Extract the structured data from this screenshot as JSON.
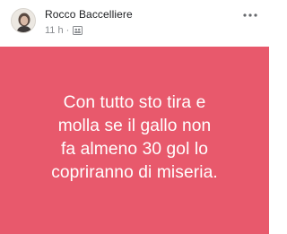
{
  "post": {
    "author": "Rocco Baccelliere",
    "time": "11 h",
    "separator": "·",
    "audience_icon": "friends-icon",
    "more_icon": "more-dots-icon",
    "body_text": "Con tutto sto tira e\nmolla se il gallo non\nfa almeno 30 gol lo\ncopriranno di miseria.",
    "background_color": "#e8596c",
    "text_color": "#ffffff"
  }
}
